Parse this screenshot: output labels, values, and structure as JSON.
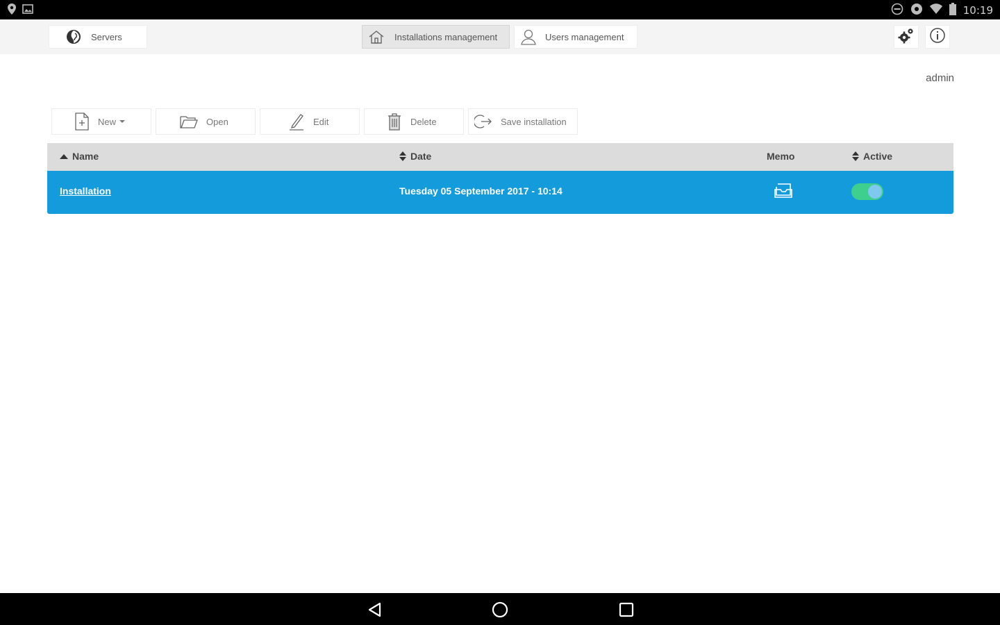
{
  "status_bar": {
    "time": "10:19",
    "icons_left": [
      "location-icon",
      "image-icon"
    ],
    "icons_right": [
      "dnd-icon",
      "sync-icon",
      "wifi-icon",
      "battery-icon"
    ]
  },
  "nav": {
    "servers_label": "Servers",
    "installations_label": "Installations management",
    "users_label": "Users management",
    "active_tab": "installations"
  },
  "user": {
    "name": "admin"
  },
  "toolbar": {
    "new_label": "New",
    "open_label": "Open",
    "edit_label": "Edit",
    "delete_label": "Delete",
    "save_label": "Save installation"
  },
  "table": {
    "columns": {
      "name": "Name",
      "date": "Date",
      "memo": "Memo",
      "active": "Active"
    },
    "rows": [
      {
        "name": "Installation",
        "date": "Tuesday 05 September 2017 - 10:14",
        "active": true
      }
    ]
  },
  "colors": {
    "row_selected": "#149bdb",
    "toggle_on": "#3ecf8e",
    "header_bg": "#dcdcdc"
  }
}
